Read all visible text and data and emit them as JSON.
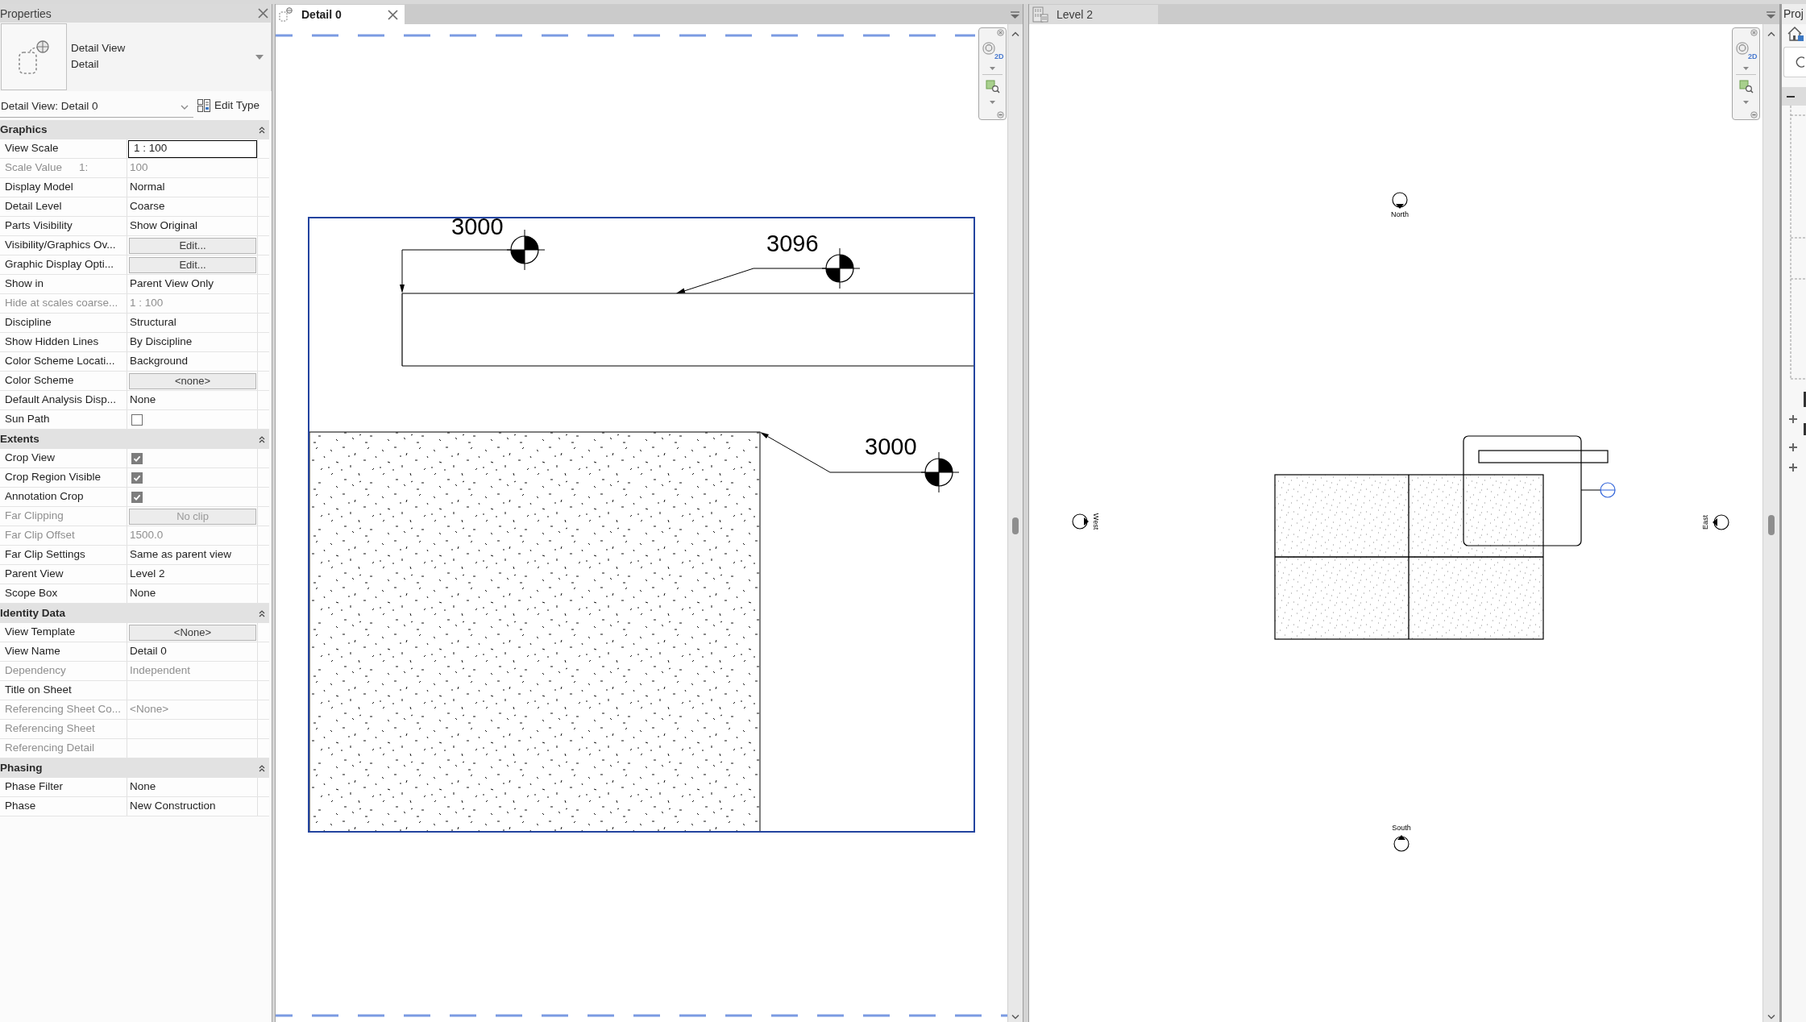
{
  "properties_panel": {
    "title": "Properties",
    "type_selector": {
      "family": "Detail View",
      "type": "Detail"
    },
    "instance_selector": "Detail View: Detail 0",
    "edit_type_button": "Edit Type",
    "sections": [
      {
        "title": "Graphics",
        "expanded": true,
        "rows": [
          {
            "label": "View Scale",
            "kind": "input",
            "value": "1 : 100",
            "disabled": false
          },
          {
            "label": "Scale Value",
            "label_suffix": "1:",
            "kind": "text",
            "value": "100",
            "disabled": true
          },
          {
            "label": "Display Model",
            "kind": "text",
            "value": "Normal",
            "disabled": false
          },
          {
            "label": "Detail Level",
            "kind": "text",
            "value": "Coarse",
            "disabled": false
          },
          {
            "label": "Parts Visibility",
            "kind": "text",
            "value": "Show Original",
            "disabled": false
          },
          {
            "label": "Visibility/Graphics Ov...",
            "kind": "button",
            "value": "Edit...",
            "disabled": false
          },
          {
            "label": "Graphic Display Opti...",
            "kind": "button",
            "value": "Edit...",
            "disabled": false
          },
          {
            "label": "Show in",
            "kind": "text",
            "value": "Parent View Only",
            "disabled": false
          },
          {
            "label": "Hide at scales coarse...",
            "kind": "text",
            "value": "1 : 100",
            "disabled": true
          },
          {
            "label": "Discipline",
            "kind": "text",
            "value": "Structural",
            "disabled": false
          },
          {
            "label": "Show Hidden Lines",
            "kind": "text",
            "value": "By Discipline",
            "disabled": false
          },
          {
            "label": "Color Scheme Locati...",
            "kind": "text",
            "value": "Background",
            "disabled": false
          },
          {
            "label": "Color Scheme",
            "kind": "button",
            "value": "<none>",
            "disabled": false
          },
          {
            "label": "Default Analysis Disp...",
            "kind": "text",
            "value": "None",
            "disabled": false
          },
          {
            "label": "Sun Path",
            "kind": "checkbox",
            "checked": false,
            "disabled": false
          }
        ]
      },
      {
        "title": "Extents",
        "expanded": true,
        "rows": [
          {
            "label": "Crop View",
            "kind": "checkbox",
            "checked": true,
            "disabled": false
          },
          {
            "label": "Crop Region Visible",
            "kind": "checkbox",
            "checked": true,
            "disabled": false
          },
          {
            "label": "Annotation Crop",
            "kind": "checkbox",
            "checked": true,
            "disabled": false
          },
          {
            "label": "Far Clipping",
            "kind": "button",
            "value": "No clip",
            "disabled": true
          },
          {
            "label": "Far Clip Offset",
            "kind": "text",
            "value": "1500.0",
            "disabled": true
          },
          {
            "label": "Far Clip Settings",
            "kind": "text",
            "value": "Same as parent view",
            "disabled": false
          },
          {
            "label": "Parent View",
            "kind": "text",
            "value": "Level 2",
            "disabled": false
          },
          {
            "label": "Scope Box",
            "kind": "text",
            "value": "None",
            "disabled": false
          }
        ]
      },
      {
        "title": "Identity Data",
        "expanded": true,
        "rows": [
          {
            "label": "View Template",
            "kind": "button",
            "value": "<None>",
            "disabled": false
          },
          {
            "label": "View Name",
            "kind": "text",
            "value": "Detail 0",
            "disabled": false
          },
          {
            "label": "Dependency",
            "kind": "text",
            "value": "Independent",
            "disabled": true
          },
          {
            "label": "Title on Sheet",
            "kind": "text",
            "disabled": false
          },
          {
            "label": "Referencing Sheet Co...",
            "kind": "text",
            "value": "<None>",
            "disabled": true
          },
          {
            "label": "Referencing Sheet",
            "kind": "text",
            "disabled": true
          },
          {
            "label": "Referencing Detail",
            "kind": "text",
            "disabled": true
          }
        ]
      },
      {
        "title": "Phasing",
        "expanded": true,
        "rows": [
          {
            "label": "Phase Filter",
            "kind": "text",
            "value": "None",
            "disabled": false
          },
          {
            "label": "Phase",
            "kind": "text",
            "value": "New Construction",
            "disabled": false
          }
        ]
      }
    ]
  },
  "detail_view": {
    "tab": {
      "label": "Detail 0",
      "selected": true
    },
    "navigation_bar": {
      "wheel_label": "2D"
    },
    "spot_elevations": [
      {
        "label": "3000"
      },
      {
        "label": "3096"
      },
      {
        "label": "3000"
      }
    ]
  },
  "plan_view": {
    "tab": {
      "label": "Level 2",
      "selected": false
    },
    "navigation_bar": {
      "wheel_label": "2D"
    },
    "elevation_markers": [
      {
        "label": "North"
      },
      {
        "label": "West"
      },
      {
        "label": "East"
      },
      {
        "label": "South"
      }
    ]
  },
  "project_browser": {
    "title": "Proj"
  }
}
